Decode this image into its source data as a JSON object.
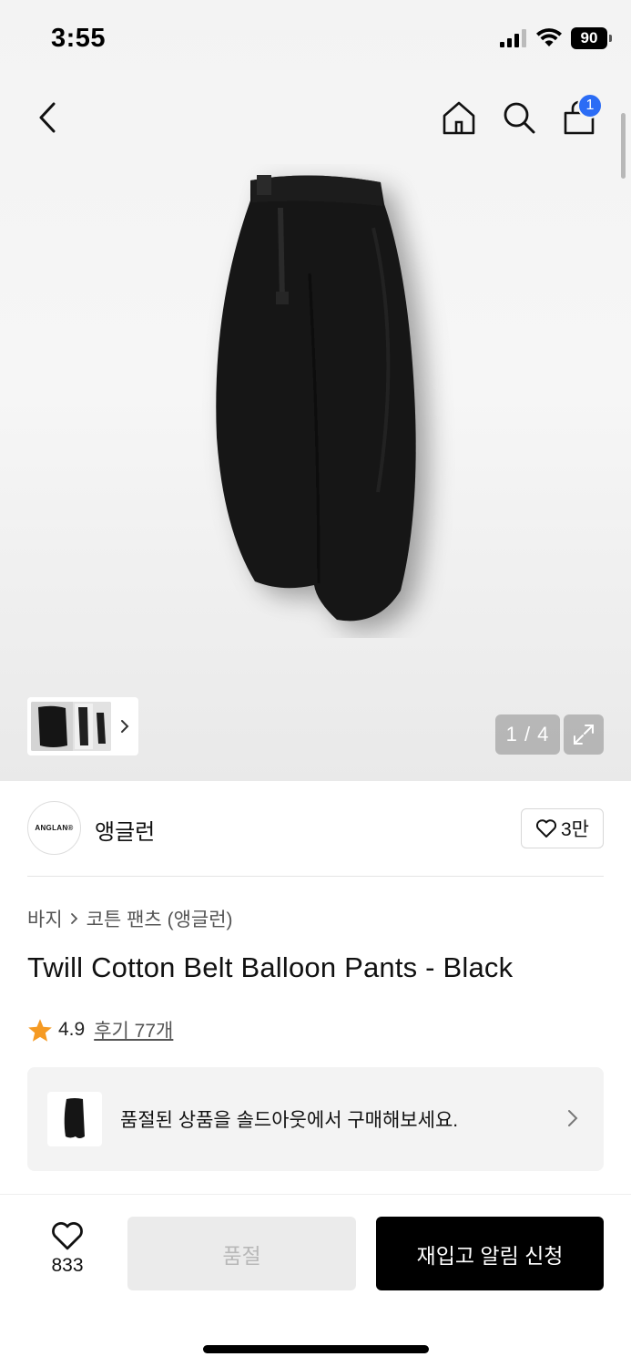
{
  "status_bar": {
    "time": "3:55",
    "battery": "90",
    "icons": [
      "signal-icon",
      "wifi-icon",
      "battery-icon"
    ]
  },
  "nav": {
    "icons": [
      "back-icon",
      "home-icon",
      "search-icon",
      "cart-icon"
    ],
    "cart_count": "1"
  },
  "gallery": {
    "pager": "1 / 4",
    "icons": [
      "chevron-right-icon",
      "expand-icon"
    ]
  },
  "brand": {
    "logo_text": "ANGLAN®",
    "name": "앵글런",
    "likes": "3만"
  },
  "breadcrumb": {
    "category": "바지",
    "subcategory": "코튼 팬츠 (앵글런)"
  },
  "product": {
    "title": "Twill Cotton Belt Balloon Pants - Black",
    "rating": "4.9",
    "reviews": "후기 77개"
  },
  "soldout_banner": {
    "text": "품절된 상품을 솔드아웃에서 구매해보세요."
  },
  "actions": {
    "wish_count": "833",
    "soldout_label": "품절",
    "restock_label": "재입고 알림 신청"
  },
  "colors": {
    "accent_badge": "#2b6cf5",
    "star": "#f59a23",
    "primary_button": "#000000",
    "disabled_button": "#ebebeb"
  }
}
